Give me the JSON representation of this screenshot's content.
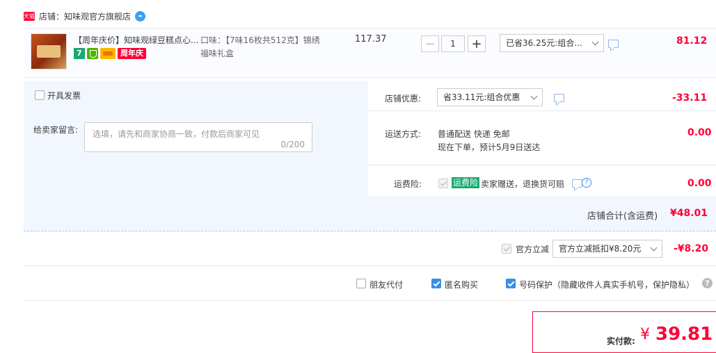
{
  "shop": {
    "badge": "天猫",
    "label": "店铺：知味观官方旗舰店"
  },
  "item": {
    "title": "【周年庆价】知味观绿豆糕点心...",
    "tag_seven": "7",
    "tag_anniversary": "周年庆",
    "sku_line1": "口味：【7味16枚共512克】锦绣",
    "sku_line2": "福味礼盒",
    "unit_price": "117.37",
    "qty_minus": "−",
    "quantity": "1",
    "qty_plus": "+",
    "discount_select": "已省36.25元:组合...",
    "total": "81.12"
  },
  "left_panel": {
    "invoice_label": "开具发票",
    "message_label": "给卖家留言:",
    "message_placeholder": "选填，请先和商家协商一致，付款后商家可见",
    "message_counter": "0/200"
  },
  "right_panel": {
    "shop_discount_label": "店铺优惠:",
    "shop_discount_select": "省33.11元:组合优惠",
    "shop_discount_value": "-33.11",
    "shipping_label": "运送方式:",
    "shipping_line1": "普通配送 快递 免邮",
    "shipping_line2": "现在下单，预计5月9日送达",
    "shipping_value": "0.00",
    "insurance_label": "运费险:",
    "insurance_badge": "运费险",
    "insurance_text": "卖家赠送，退换货可赔",
    "insurance_value": "0.00"
  },
  "subtotal": {
    "label": "店铺合计(含运费)",
    "value": "¥48.01"
  },
  "official": {
    "label": "官方立减",
    "select": "官方立减抵扣¥8.20元",
    "value": "-¥8.20"
  },
  "options": {
    "friend_pay": "朋友代付",
    "anonymous": "匿名购买",
    "number_protect": "号码保护（隐藏收件人真实手机号，保护隐私）",
    "help": "?"
  },
  "payment": {
    "label": "实付款:",
    "currency": "¥",
    "amount": "39.81"
  },
  "colors": {
    "accent_red": "#ff0036",
    "accent_blue": "#3a8ee6",
    "panel_bg": "#f2f7ff"
  }
}
